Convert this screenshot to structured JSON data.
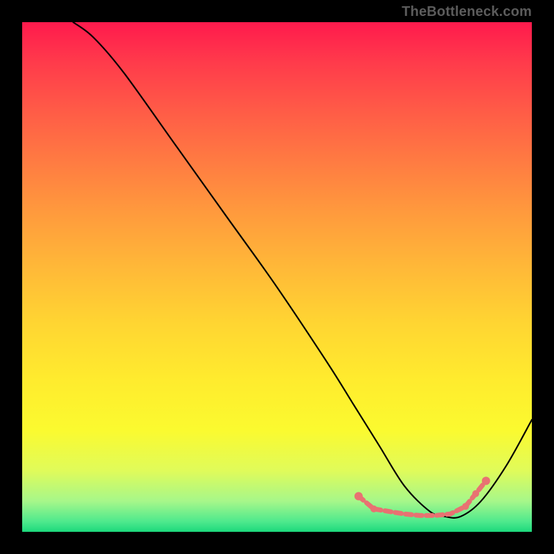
{
  "attribution": "TheBottleneck.com",
  "colors": {
    "background": "#000000",
    "curve": "#000000",
    "marker": "#e87272"
  },
  "chart_data": {
    "type": "line",
    "title": "",
    "xlabel": "",
    "ylabel": "",
    "xlim": [
      0,
      100
    ],
    "ylim": [
      0,
      100
    ],
    "series": [
      {
        "name": "bottleneck-curve",
        "x": [
          10,
          14,
          20,
          30,
          40,
          50,
          60,
          65,
          70,
          75,
          80,
          83,
          86,
          90,
          95,
          100
        ],
        "y": [
          100,
          97,
          90,
          76,
          62,
          48,
          33,
          25,
          17,
          9,
          4,
          3,
          3,
          6,
          13,
          22
        ]
      }
    ],
    "markers": {
      "name": "highlighted-range",
      "points": [
        {
          "x": 66,
          "y": 7
        },
        {
          "x": 69,
          "y": 4.5
        },
        {
          "x": 72,
          "y": 4
        },
        {
          "x": 75,
          "y": 3.5
        },
        {
          "x": 78,
          "y": 3.2
        },
        {
          "x": 81,
          "y": 3.2
        },
        {
          "x": 84,
          "y": 3.5
        },
        {
          "x": 87,
          "y": 5
        },
        {
          "x": 89,
          "y": 7.5
        },
        {
          "x": 91,
          "y": 10
        }
      ]
    },
    "gradient_stops": [
      {
        "pos": 0,
        "color": "#ff1a4d"
      },
      {
        "pos": 50,
        "color": "#ffb838"
      },
      {
        "pos": 80,
        "color": "#fbfa2f"
      },
      {
        "pos": 100,
        "color": "#1cd97c"
      }
    ]
  }
}
